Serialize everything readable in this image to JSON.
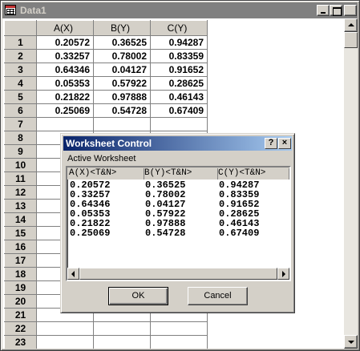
{
  "window": {
    "title": "Data1"
  },
  "worksheet": {
    "columns": [
      "A(X)",
      "B(Y)",
      "C(Y)"
    ],
    "row_numbers": [
      "1",
      "2",
      "3",
      "4",
      "5",
      "6",
      "7",
      "8",
      "9",
      "10",
      "11",
      "12",
      "13",
      "14",
      "15",
      "16",
      "17",
      "18",
      "19",
      "20",
      "21",
      "22",
      "23"
    ],
    "data": [
      [
        "0.20572",
        "0.36525",
        "0.94287"
      ],
      [
        "0.33257",
        "0.78002",
        "0.83359"
      ],
      [
        "0.64346",
        "0.04127",
        "0.91652"
      ],
      [
        "0.05353",
        "0.57922",
        "0.28625"
      ],
      [
        "0.21822",
        "0.97888",
        "0.46143"
      ],
      [
        "0.25069",
        "0.54728",
        "0.67409"
      ]
    ]
  },
  "dialog": {
    "title": "Worksheet Control",
    "help_label": "?",
    "close_label": "×",
    "group_label": "Active Worksheet",
    "columns": [
      "A(X)<T&N>",
      "B(Y)<T&N>",
      "C(Y)<T&N>"
    ],
    "rows": [
      [
        "0.20572",
        "0.36525",
        "0.94287"
      ],
      [
        "0.33257",
        "0.78002",
        "0.83359"
      ],
      [
        "0.64346",
        "0.04127",
        "0.91652"
      ],
      [
        "0.05353",
        "0.57922",
        "0.28625"
      ],
      [
        "0.21822",
        "0.97888",
        "0.46143"
      ],
      [
        "0.25069",
        "0.54728",
        "0.67409"
      ]
    ],
    "ok_label": "OK",
    "cancel_label": "Cancel"
  }
}
